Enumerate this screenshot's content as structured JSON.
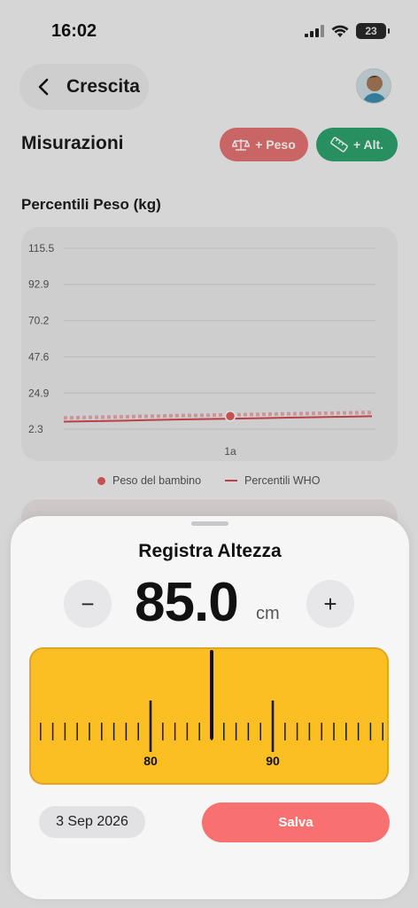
{
  "status_bar": {
    "time": "16:02",
    "battery": "23"
  },
  "nav": {
    "title": "Crescita"
  },
  "measurements": {
    "title": "Misurazioni",
    "add_weight_label": "+ Peso",
    "add_height_label": "+ Alt."
  },
  "chart_title": "Percentili Peso (kg)",
  "chart_data": {
    "type": "line",
    "yticks": [
      "115.5",
      "92.9",
      "70.2",
      "47.6",
      "24.9",
      "2.3"
    ],
    "ylim": [
      2.3,
      115.5
    ],
    "xticks": [
      "1a"
    ],
    "series": [
      {
        "name": "Peso del bambino",
        "points": [
          {
            "x": "1a",
            "y": 10.5
          }
        ]
      },
      {
        "name": "Percentili WHO",
        "values": [
          7.0,
          7.3,
          7.6,
          8.0,
          8.3,
          8.6,
          8.9,
          9.2,
          9.5,
          9.8,
          10.1,
          10.4
        ]
      }
    ],
    "legend_placement": "bottom",
    "grid": true
  },
  "legend": {
    "child": "Peso del bambino",
    "who": "Percentili WHO"
  },
  "sheet": {
    "title": "Registra Altezza",
    "value": "85.0",
    "unit": "cm",
    "minus_label": "−",
    "plus_label": "+",
    "ruler_labels": [
      "80",
      "90"
    ],
    "date": "3 Sep 2026",
    "save_label": "Salva"
  },
  "colors": {
    "weight": "#e57373",
    "height": "#2ea36f",
    "ruler": "#fbbf24",
    "save": "#f87171"
  }
}
